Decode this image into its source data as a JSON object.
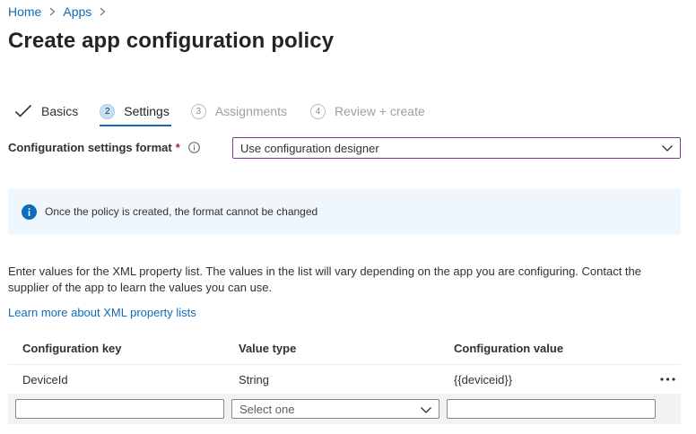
{
  "breadcrumb": {
    "items": [
      "Home",
      "Apps"
    ]
  },
  "page": {
    "title": "Create app configuration policy"
  },
  "steps": [
    {
      "label": "Basics",
      "state": "completed",
      "number": "1"
    },
    {
      "label": "Settings",
      "state": "active",
      "number": "2"
    },
    {
      "label": "Assignments",
      "state": "disabled",
      "number": "3"
    },
    {
      "label": "Review + create",
      "state": "disabled",
      "number": "4"
    }
  ],
  "format": {
    "label": "Configuration settings format",
    "required_mark": "*",
    "selected": "Use configuration designer"
  },
  "banner": {
    "text": "Once the policy is created, the format cannot be changed"
  },
  "description": "Enter values for the XML property list. The values in the list will vary depending on the app you are configuring. Contact the supplier of the app to learn the values you can use.",
  "learn_more": "Learn more about XML property lists",
  "table": {
    "headers": [
      "Configuration key",
      "Value type",
      "Configuration value"
    ],
    "rows": [
      {
        "key": "DeviceId",
        "type": "String",
        "value": "{{deviceid}}"
      }
    ],
    "new_row": {
      "key_value": "",
      "type_placeholder": "Select one",
      "value_value": ""
    }
  },
  "colors": {
    "link": "#0f6cbd",
    "accent": "#0f6cbd",
    "banner_bg": "#eff6fc",
    "select_border": "#7a3b8f",
    "required": "#a4262c"
  }
}
